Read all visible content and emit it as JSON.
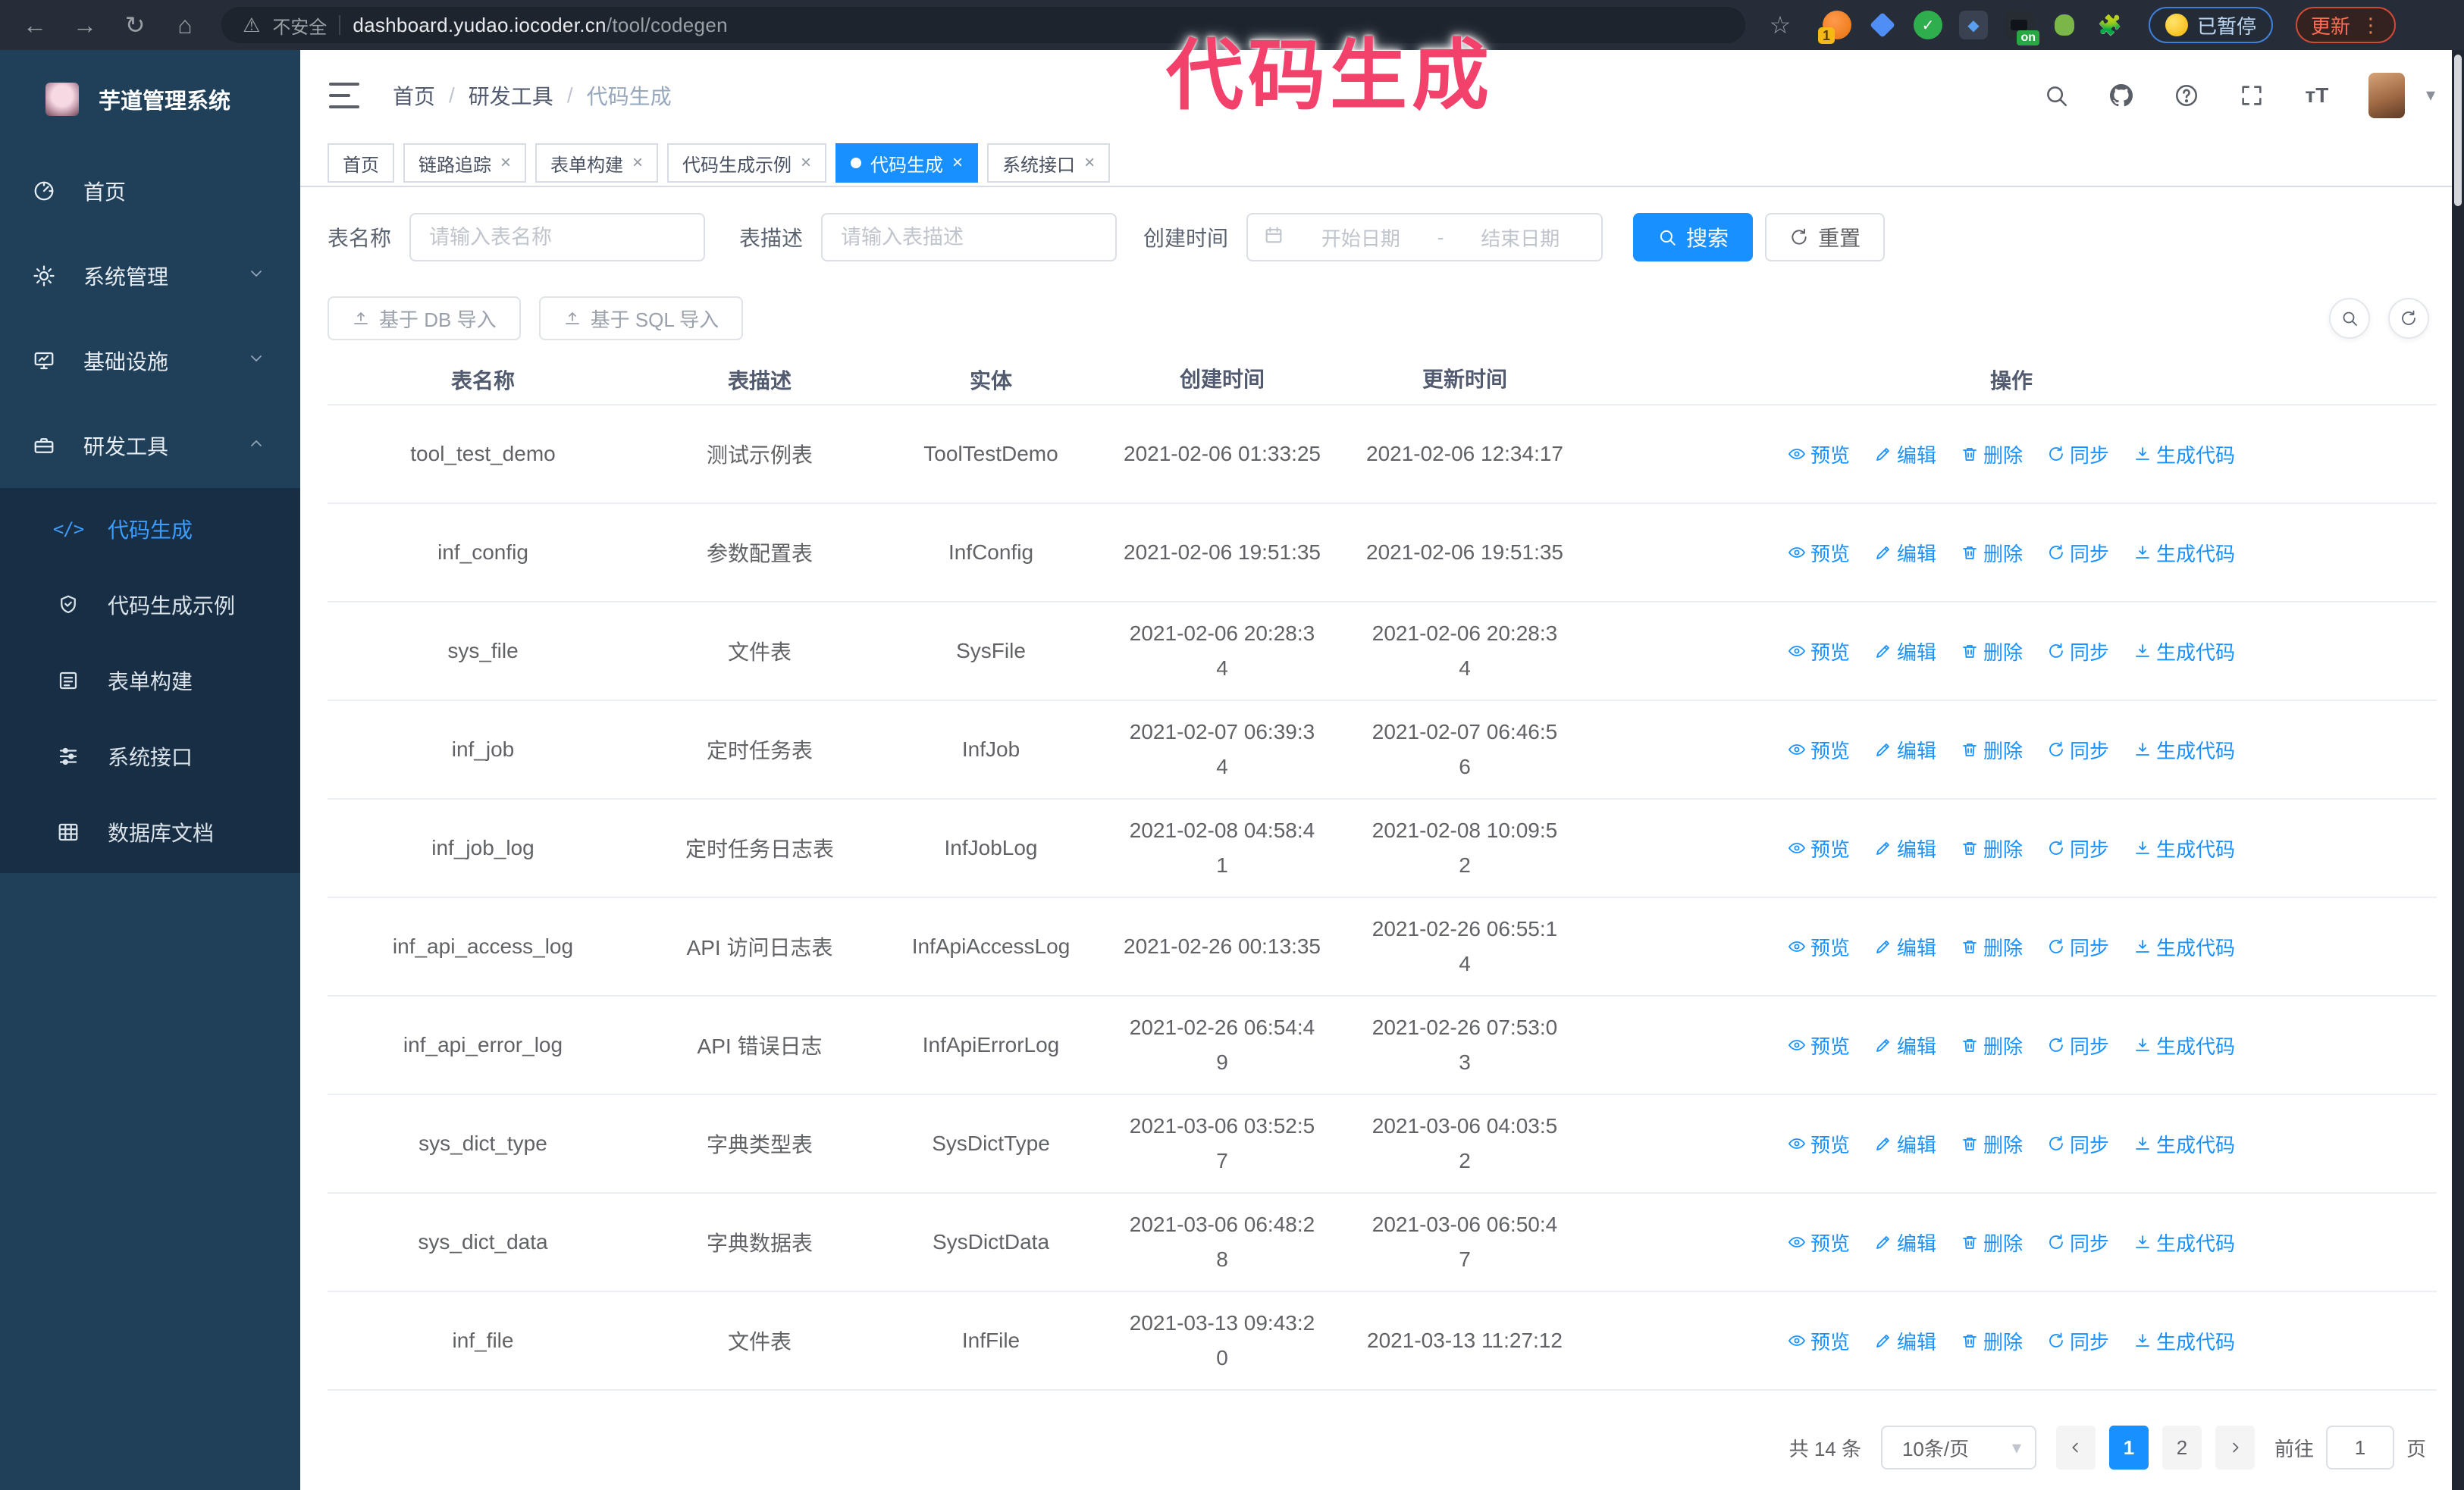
{
  "browser": {
    "security_label": "不安全",
    "url_domain": "dashboard.yudao.iocoder.cn",
    "url_path": "/tool/codegen",
    "paused_badge": "已暂停",
    "update_label": "更新",
    "ext_badge": "1",
    "ext_on": "on"
  },
  "icons": {
    "back": "←",
    "forward": "→",
    "reload": "↻",
    "home": "⌂",
    "warning": "⚠",
    "star": "☆",
    "ellipsis": "⋮",
    "caret_down": "▾",
    "close": "×"
  },
  "annotation": {
    "title": "代码生成"
  },
  "sidebar": {
    "app_title": "芋道管理系统",
    "items": [
      {
        "label": "首页"
      },
      {
        "label": "系统管理"
      },
      {
        "label": "基础设施"
      },
      {
        "label": "研发工具"
      }
    ],
    "subitems": [
      {
        "label": "代码生成",
        "active": true
      },
      {
        "label": "代码生成示例"
      },
      {
        "label": "表单构建"
      },
      {
        "label": "系统接口"
      },
      {
        "label": "数据库文档"
      }
    ]
  },
  "header": {
    "breadcrumb": [
      "首页",
      "研发工具",
      "代码生成"
    ],
    "separator": "/"
  },
  "tabs": [
    {
      "label": "首页",
      "closable": false,
      "active": false
    },
    {
      "label": "链路追踪",
      "closable": true,
      "active": false
    },
    {
      "label": "表单构建",
      "closable": true,
      "active": false
    },
    {
      "label": "代码生成示例",
      "closable": true,
      "active": false
    },
    {
      "label": "代码生成",
      "closable": true,
      "active": true
    },
    {
      "label": "系统接口",
      "closable": true,
      "active": false
    }
  ],
  "search": {
    "name_label": "表名称",
    "name_placeholder": "请输入表名称",
    "desc_label": "表描述",
    "desc_placeholder": "请输入表描述",
    "time_label": "创建时间",
    "start_placeholder": "开始日期",
    "range_separator": "-",
    "end_placeholder": "结束日期",
    "search_label": "搜索",
    "reset_label": "重置"
  },
  "toolbar": {
    "db_import": "基于 DB 导入",
    "sql_import": "基于 SQL 导入"
  },
  "table": {
    "columns": [
      "表名称",
      "表描述",
      "实体",
      "创建时间",
      "更新时间",
      "操作"
    ],
    "actions": [
      {
        "label": "预览",
        "icon": "eye",
        "name": "preview"
      },
      {
        "label": "编辑",
        "icon": "edit",
        "name": "edit"
      },
      {
        "label": "删除",
        "icon": "delete",
        "name": "delete"
      },
      {
        "label": "同步",
        "icon": "sync",
        "name": "sync"
      },
      {
        "label": "生成代码",
        "icon": "download",
        "name": "generate-code"
      }
    ],
    "rows": [
      {
        "name": "tool_test_demo",
        "desc": "测试示例表",
        "entity": "ToolTestDemo",
        "created": "2021-02-06 01:33:25",
        "updated": "2021-02-06 12:34:17"
      },
      {
        "name": "inf_config",
        "desc": "参数配置表",
        "entity": "InfConfig",
        "created": "2021-02-06 19:51:35",
        "updated": "2021-02-06 19:51:35"
      },
      {
        "name": "sys_file",
        "desc": "文件表",
        "entity": "SysFile",
        "created": "2021-02-06 20:28:3\n4",
        "updated": "2021-02-06 20:28:3\n4"
      },
      {
        "name": "inf_job",
        "desc": "定时任务表",
        "entity": "InfJob",
        "created": "2021-02-07 06:39:3\n4",
        "updated": "2021-02-07 06:46:5\n6"
      },
      {
        "name": "inf_job_log",
        "desc": "定时任务日志表",
        "entity": "InfJobLog",
        "created": "2021-02-08 04:58:4\n1",
        "updated": "2021-02-08 10:09:5\n2"
      },
      {
        "name": "inf_api_access_log",
        "desc": "API 访问日志表",
        "entity": "InfApiAccessLog",
        "created": "2021-02-26 00:13:35",
        "updated": "2021-02-26 06:55:1\n4"
      },
      {
        "name": "inf_api_error_log",
        "desc": "API 错误日志",
        "entity": "InfApiErrorLog",
        "created": "2021-02-26 06:54:4\n9",
        "updated": "2021-02-26 07:53:0\n3"
      },
      {
        "name": "sys_dict_type",
        "desc": "字典类型表",
        "entity": "SysDictType",
        "created": "2021-03-06 03:52:5\n7",
        "updated": "2021-03-06 04:03:5\n2"
      },
      {
        "name": "sys_dict_data",
        "desc": "字典数据表",
        "entity": "SysDictData",
        "created": "2021-03-06 06:48:2\n8",
        "updated": "2021-03-06 06:50:4\n7"
      },
      {
        "name": "inf_file",
        "desc": "文件表",
        "entity": "InfFile",
        "created": "2021-03-13 09:43:2\n0",
        "updated": "2021-03-13 11:27:12"
      }
    ]
  },
  "pagination": {
    "total": "共 14 条",
    "page_size": "10条/页",
    "pages": [
      "1",
      "2"
    ],
    "active_page": "1",
    "goto_label": "前往",
    "page_value": "1",
    "page_unit": "页"
  },
  "colors": {
    "accent": "#1890ff",
    "annotation": "#f2416b",
    "sidebar_bg": "#20405a",
    "submenu_bg": "#172e44",
    "browser_bar_bg": "#262d38",
    "link": "#1890ff"
  }
}
